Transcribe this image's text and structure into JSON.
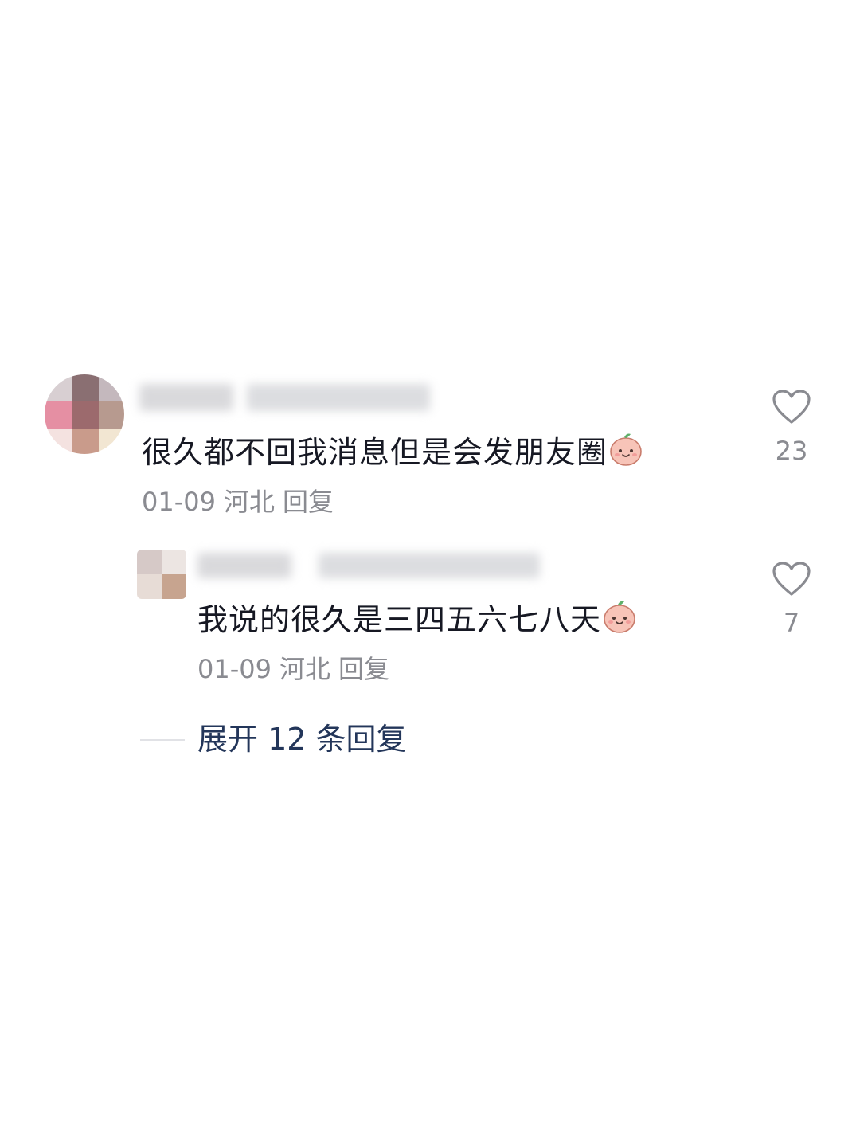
{
  "comments": [
    {
      "text": "很久都不回我消息但是会发朋友圈",
      "emoji": "peach-smile-emoji",
      "date": "01-09",
      "location": "河北",
      "reply_label": "回复",
      "likes": "23"
    }
  ],
  "replies": [
    {
      "text": "我说的很久是三四五六七八天",
      "emoji": "peach-smile-emoji",
      "date": "01-09",
      "location": "河北",
      "reply_label": "回复",
      "likes": "7"
    }
  ],
  "expand_label": "展开 12 条回复",
  "colors": {
    "text": "#161823",
    "meta": "#8a8b91",
    "expand": "#23365a",
    "heart_outline": "#8a8b91"
  },
  "icons": [
    "heart-outline-icon",
    "peach-smile-emoji"
  ]
}
